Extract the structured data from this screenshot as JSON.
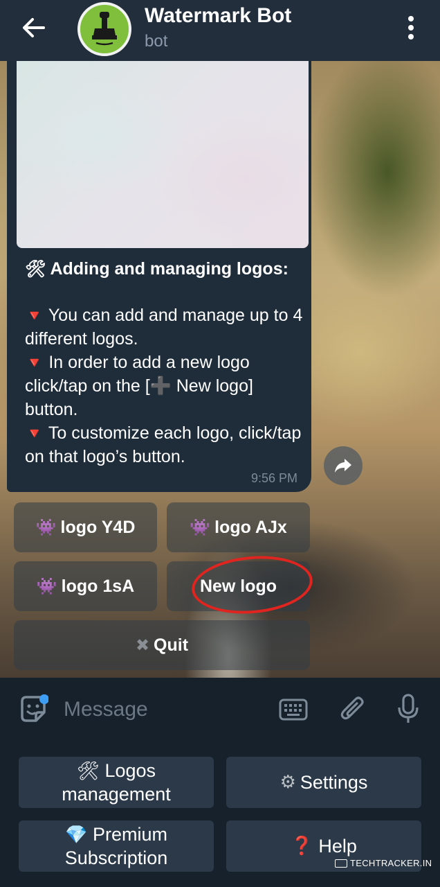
{
  "header": {
    "title": "Watermark Bot",
    "subtitle": "bot",
    "back_icon": "arrow-left-icon",
    "menu_icon": "vertical-dots-icon",
    "avatar_icon": "stamp-icon",
    "avatar_color": "#7fbf3c"
  },
  "message": {
    "heading_emoji": "🛠",
    "heading": "Adding and managing logos:",
    "bullet_emoji": "🔻",
    "line1": "You can add and manage up to 4 different logos.",
    "line2a": "In order to add a new logo click/tap on the [",
    "line2_plus": "➕",
    "line2b": " New logo] button.",
    "line3": "To customize each logo, click/tap on that logo’s button.",
    "time": "9:56 PM"
  },
  "inline_keyboard": {
    "logo_emoji": "👾",
    "logo1": "logo Y4D",
    "logo2": "logo AJx",
    "logo3": "logo 1sA",
    "new_logo": "New logo",
    "quit_emoji": "✖",
    "quit": "Quit"
  },
  "input": {
    "placeholder": "Message",
    "sticker_icon": "sticker-icon",
    "keyboard_icon": "keyboard-icon",
    "attach_icon": "paperclip-icon",
    "mic_icon": "microphone-icon"
  },
  "reply_keyboard": {
    "logos_emoji": "🛠",
    "logos_line1": "Logos",
    "logos_line2": "management",
    "settings_emoji": "⚙",
    "settings": "Settings",
    "premium_emoji": "💎",
    "premium_line1": "Premium",
    "premium_line2": "Subscription",
    "help_emoji": "❓",
    "help": "Help"
  },
  "watermark": "TECHTRACKER.IN",
  "colors": {
    "header_bg": "#232e3c",
    "bubble_bg": "#1f2c3a",
    "accent_red": "#e0241f",
    "unread_dot": "#3d9df2"
  }
}
